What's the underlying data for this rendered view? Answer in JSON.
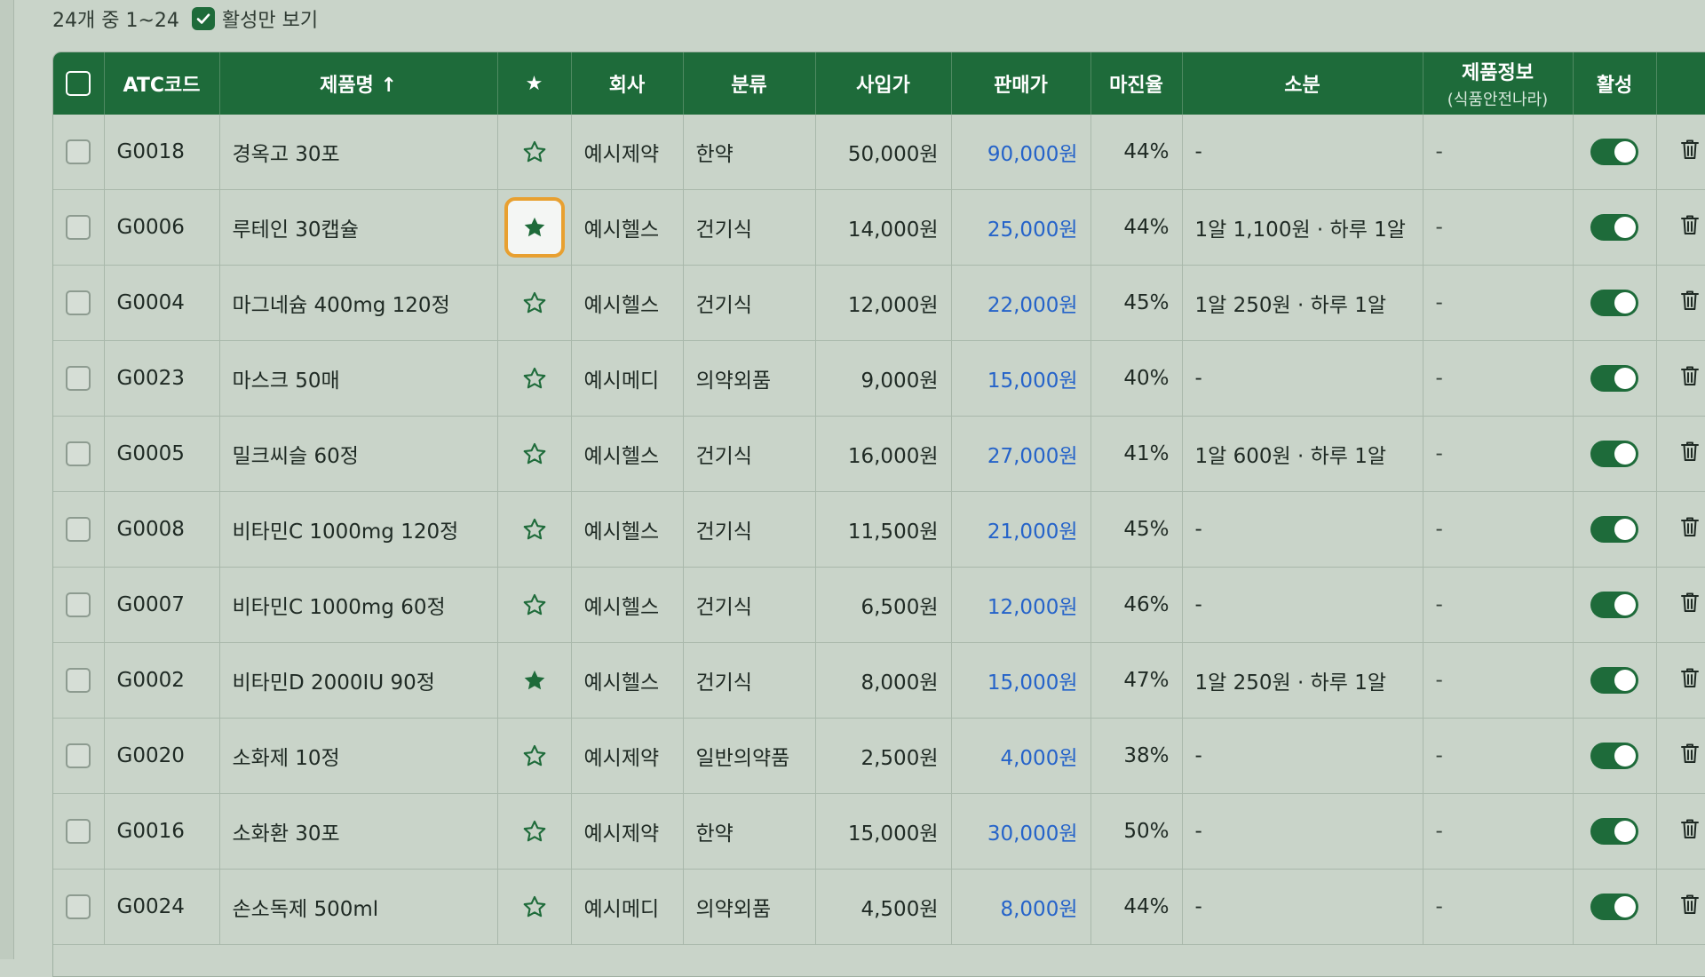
{
  "summary": {
    "count_text": "24개 중 1~24",
    "active_only_label": "활성만 보기",
    "active_only_checked": true
  },
  "columns": {
    "atc": "ATC코드",
    "name": "제품명 ↑",
    "star": "★",
    "company": "회사",
    "category": "분류",
    "cost": "사입가",
    "price": "판매가",
    "margin": "마진율",
    "portion": "소분",
    "info": "제품정보",
    "info_sub": "(식품안전나라)",
    "active": "활성"
  },
  "rows": [
    {
      "code": "G0018",
      "name": "경옥고 30포",
      "starred": false,
      "company": "예시제약",
      "category": "한약",
      "cost": "50,000원",
      "price": "90,000원",
      "margin": "44%",
      "portion": "-",
      "info": "-",
      "active": true
    },
    {
      "code": "G0006",
      "name": "루테인 30캡슐",
      "starred": true,
      "focused": true,
      "company": "예시헬스",
      "category": "건기식",
      "cost": "14,000원",
      "price": "25,000원",
      "margin": "44%",
      "portion": "1알 1,100원 · 하루 1알",
      "info": "-",
      "active": true
    },
    {
      "code": "G0004",
      "name": "마그네슘 400mg 120정",
      "starred": false,
      "company": "예시헬스",
      "category": "건기식",
      "cost": "12,000원",
      "price": "22,000원",
      "margin": "45%",
      "portion": "1알 250원 · 하루 1알",
      "info": "-",
      "active": true
    },
    {
      "code": "G0023",
      "name": "마스크 50매",
      "starred": false,
      "company": "예시메디",
      "category": "의약외품",
      "cost": "9,000원",
      "price": "15,000원",
      "margin": "40%",
      "portion": "-",
      "info": "-",
      "active": true
    },
    {
      "code": "G0005",
      "name": "밀크씨슬 60정",
      "starred": false,
      "company": "예시헬스",
      "category": "건기식",
      "cost": "16,000원",
      "price": "27,000원",
      "margin": "41%",
      "portion": "1알 600원 · 하루 1알",
      "info": "-",
      "active": true
    },
    {
      "code": "G0008",
      "name": "비타민C 1000mg 120정",
      "starred": false,
      "company": "예시헬스",
      "category": "건기식",
      "cost": "11,500원",
      "price": "21,000원",
      "margin": "45%",
      "portion": "-",
      "info": "-",
      "active": true
    },
    {
      "code": "G0007",
      "name": "비타민C 1000mg 60정",
      "starred": false,
      "company": "예시헬스",
      "category": "건기식",
      "cost": "6,500원",
      "price": "12,000원",
      "margin": "46%",
      "portion": "-",
      "info": "-",
      "active": true
    },
    {
      "code": "G0002",
      "name": "비타민D 2000IU 90정",
      "starred": true,
      "company": "예시헬스",
      "category": "건기식",
      "cost": "8,000원",
      "price": "15,000원",
      "margin": "47%",
      "portion": "1알 250원 · 하루 1알",
      "info": "-",
      "active": true
    },
    {
      "code": "G0020",
      "name": "소화제 10정",
      "starred": false,
      "company": "예시제약",
      "category": "일반의약품",
      "cost": "2,500원",
      "price": "4,000원",
      "margin": "38%",
      "portion": "-",
      "info": "-",
      "active": true
    },
    {
      "code": "G0016",
      "name": "소화환 30포",
      "starred": false,
      "company": "예시제약",
      "category": "한약",
      "cost": "15,000원",
      "price": "30,000원",
      "margin": "50%",
      "portion": "-",
      "info": "-",
      "active": true
    },
    {
      "code": "G0024",
      "name": "손소독제 500ml",
      "starred": false,
      "company": "예시메디",
      "category": "의약외품",
      "cost": "4,500원",
      "price": "8,000원",
      "margin": "44%",
      "portion": "-",
      "info": "-",
      "active": true
    }
  ],
  "colors": {
    "header_bg": "#1e6b3a",
    "price_text": "#2563c9",
    "focus_ring": "#e8a030",
    "page_bg": "#c9d4c9"
  },
  "icons": {
    "star_filled": "star-filled-icon",
    "star_outline": "star-outline-icon",
    "delete": "trash-icon",
    "check": "check-icon"
  }
}
